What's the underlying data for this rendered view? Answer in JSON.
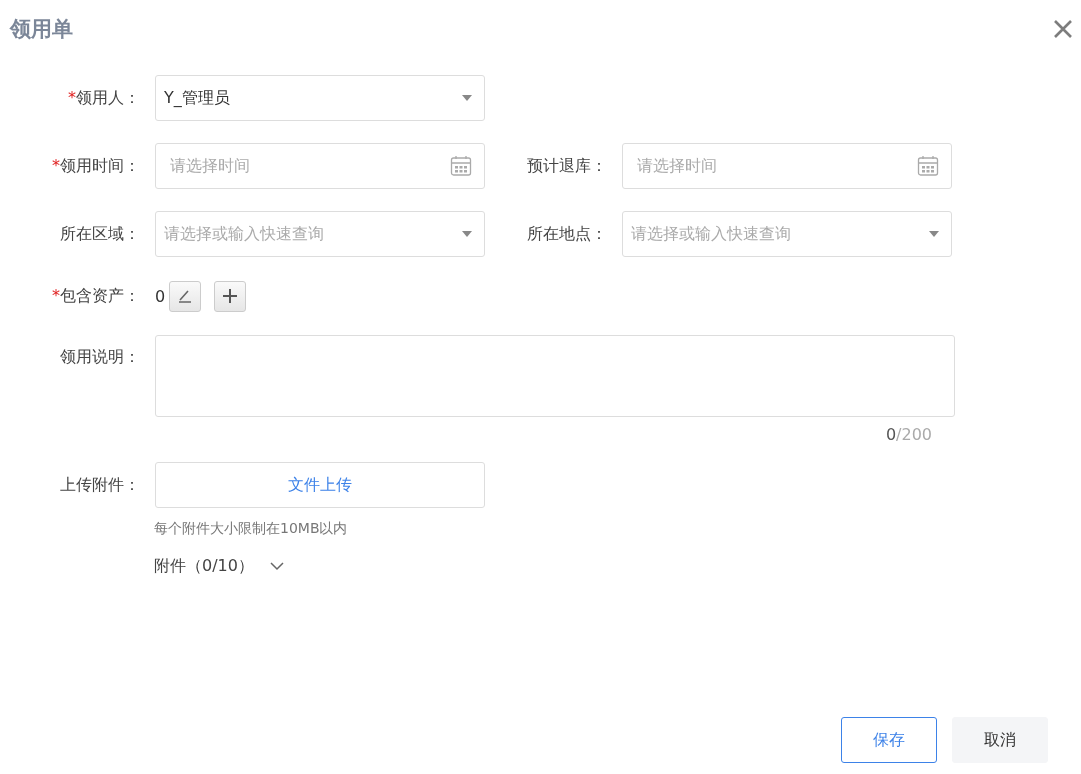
{
  "dialog": {
    "title": "领用单"
  },
  "rows": [
    {
      "fields": [
        {
          "kind": "select",
          "required_mark": "*",
          "label": "领用人：",
          "value": "Y_管理员"
        }
      ]
    },
    {
      "fields": [
        {
          "kind": "date",
          "required_mark": "*",
          "label": "领用时间：",
          "placeholder": "请选择时间"
        },
        {
          "kind": "date",
          "label": "预计退库：",
          "placeholder": "请选择时间"
        }
      ]
    },
    {
      "fields": [
        {
          "kind": "select",
          "label": "所在区域：",
          "placeholder": "请选择或输入快速查询"
        },
        {
          "kind": "select",
          "label": "所在地点：",
          "placeholder": "请选择或输入快速查询"
        }
      ]
    }
  ],
  "assets": {
    "required_mark": "*",
    "label": "包含资产：",
    "count": "0"
  },
  "note": {
    "label": "领用说明：",
    "count": "0",
    "max": "/200"
  },
  "upload": {
    "label": "上传附件：",
    "button": "文件上传",
    "hint": "每个附件大小限制在10MB以内",
    "attachments": "附件（0/10）"
  },
  "buttons": [
    {
      "kind": "primary",
      "label": "保存"
    },
    {
      "kind": "secondary",
      "label": "取消"
    }
  ]
}
